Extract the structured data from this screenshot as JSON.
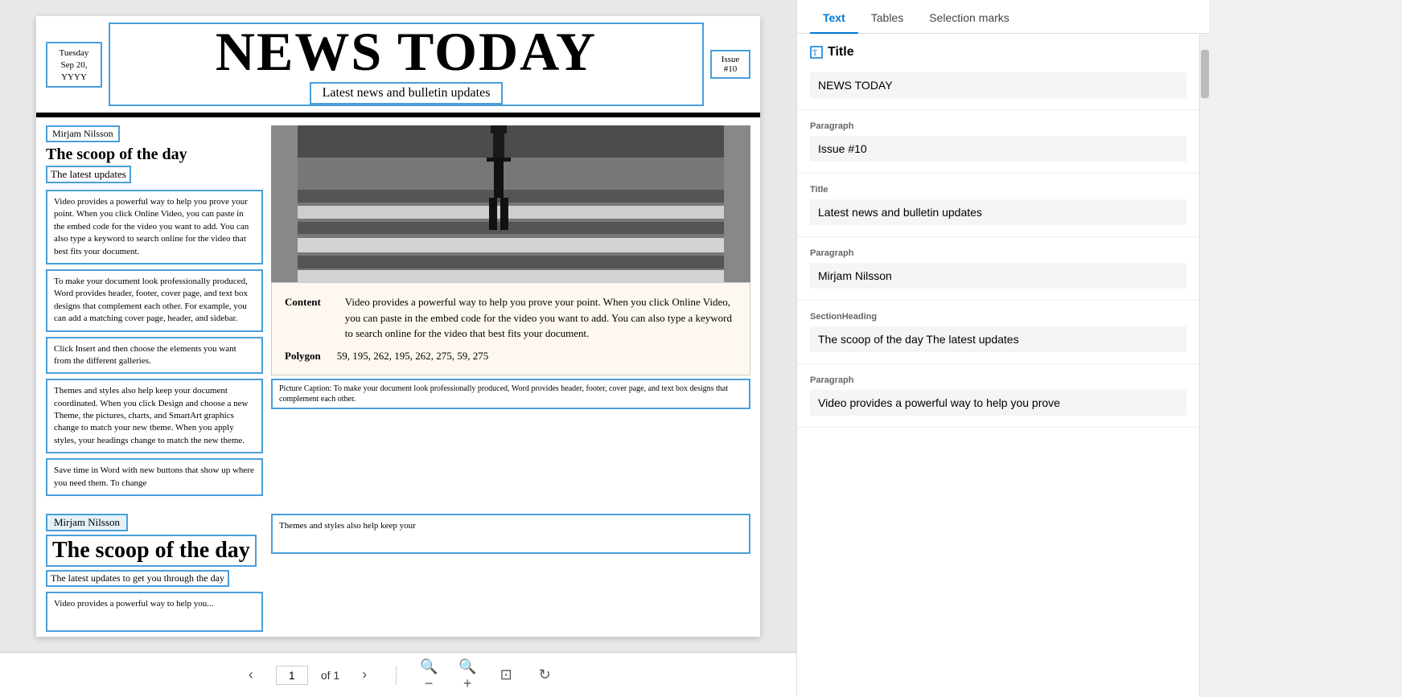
{
  "doc_viewer": {
    "newspaper": {
      "date": "Tuesday\nSep 20,\nYYYY",
      "title": "NEWS TODAY",
      "subtitle": "Latest news and bulletin updates",
      "issue": "Issue\n#10",
      "author1": "Mirjam Nilsson",
      "heading1": "The scoop of the day",
      "subheading1": "The latest updates",
      "text_block1": "Video provides a powerful way to help you prove your point. When you click Online Video, you can paste in the embed code for the video you want to add. You can also type a keyword to search online for the video that best fits your document.",
      "text_block2": "To make your document look professionally produced, Word provides header, footer, cover page, and text box designs that complement each other. For example, you can add a matching cover page, header, and sidebar.",
      "text_block3": "Click Insert and then choose the elements you want from the different galleries.",
      "text_block4": "Themes and styles also help keep your document coordinated. When you click Design and choose a new Theme, the pictures, charts, and SmartArt graphics change to match your new theme. When you apply styles, your headings change to match the new theme.",
      "text_block5": "Save time in Word with new buttons that show up where you need them. To change",
      "content_label": "Content",
      "content_text": "Video provides a powerful way to help you prove your point. When you click Online Video, you can paste in the embed code for the video you want to add. You can also type a keyword to search online for the video that best fits your document.",
      "polygon_label": "Polygon",
      "polygon_values": "59, 195, 262, 195, 262, 275, 59, 275",
      "picture_caption": "Picture Caption: To make your document look professionally produced, Word provides header, footer, cover page, and text box designs that complement each other.",
      "author2": "Mirjam Nilsson",
      "heading2": "The scoop of the day",
      "subheading2": "The latest updates to get you through the day",
      "text_bottom1": "Video provides a powerful way to help you...",
      "text_bottom2": "Themes and styles also help keep your"
    },
    "toolbar": {
      "prev_label": "‹",
      "next_label": "›",
      "page_number": "1",
      "page_of": "of 1",
      "zoom_out": "−",
      "zoom_in": "+",
      "fit_page": "⊡",
      "rotate": "↻"
    }
  },
  "right_panel": {
    "tabs": [
      {
        "id": "text",
        "label": "Text",
        "active": true
      },
      {
        "id": "tables",
        "label": "Tables",
        "active": false
      },
      {
        "id": "selection",
        "label": "Selection marks",
        "active": false
      }
    ],
    "results": [
      {
        "id": "title1",
        "label": "Title",
        "value": "NEWS TODAY"
      },
      {
        "id": "para1",
        "label": "Paragraph",
        "value": "Issue #10"
      },
      {
        "id": "title2",
        "label": "Title",
        "value": "Latest news and bulletin updates"
      },
      {
        "id": "para2",
        "label": "Paragraph",
        "value": "Mirjam Nilsson"
      },
      {
        "id": "section1",
        "label": "SectionHeading",
        "value": "The scoop of the day The latest updates"
      },
      {
        "id": "para3",
        "label": "Paragraph",
        "value": "Video provides a powerful way to help you prove"
      }
    ]
  }
}
